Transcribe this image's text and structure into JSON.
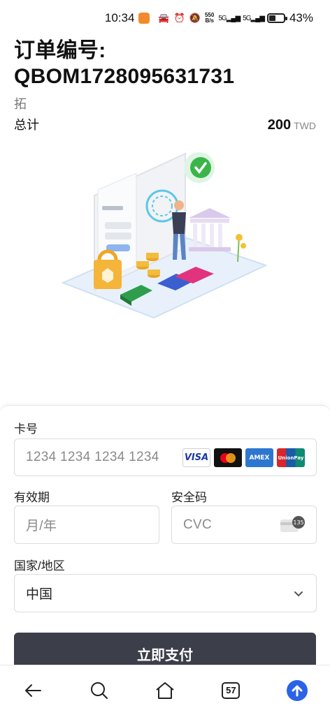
{
  "status_bar": {
    "time": "10:34",
    "network_speed_top": "550",
    "network_speed_unit": "B/s",
    "signal_1": "5G",
    "signal_2": "5G",
    "battery": "43%"
  },
  "order": {
    "title": "订单编号: QBOM1728095631731",
    "merchant": "拓",
    "total_label": "总计",
    "total_amount": "200",
    "total_currency": "TWD"
  },
  "form": {
    "card_number_label": "卡号",
    "card_number_placeholder": "1234 1234 1234 1234",
    "card_brands": [
      "VISA",
      "Mastercard",
      "AMEX",
      "UnionPay"
    ],
    "expiry_label": "有效期",
    "expiry_placeholder": "月/年",
    "cvc_label": "安全码",
    "cvc_placeholder": "CVC",
    "cvc_icon_number": "135",
    "country_label": "国家/地区",
    "country_value": "中国",
    "pay_button": "立即支付"
  },
  "bottom_nav": {
    "tab_count": "57",
    "icons": [
      "back-arrow-icon",
      "search-icon",
      "home-icon",
      "tabs-icon",
      "upload-icon"
    ]
  },
  "colors": {
    "pay_button": "#3c3f4a",
    "accent_blue": "#2b63e6",
    "placeholder": "#8a8a8a"
  }
}
